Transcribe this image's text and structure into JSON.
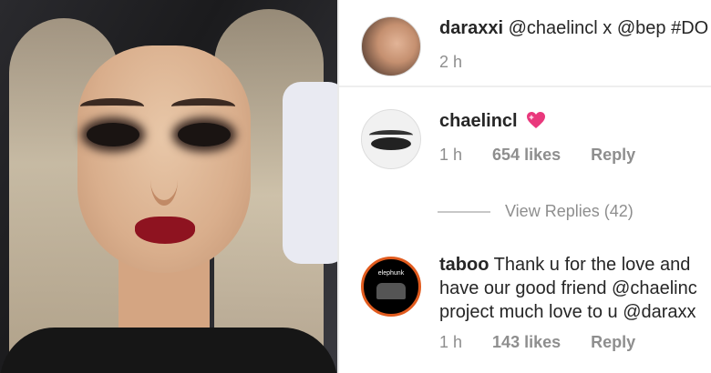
{
  "comments": [
    {
      "username": "daraxxi",
      "text": "@chaelincl x @bep #DO",
      "time": "2 h"
    },
    {
      "username": "chaelincl",
      "emoji": "sparkling-heart-icon",
      "time": "1 h",
      "likes": "654 likes",
      "reply": "Reply"
    },
    {
      "username": "taboo",
      "lines": [
        "Thank u for the love and",
        "have our good friend @chaelinc",
        "project much love to u @daraxx"
      ],
      "avatar_text": "elephunk",
      "time": "1 h",
      "likes": "143 likes",
      "reply": "Reply"
    }
  ],
  "view_replies": "View Replies (42)",
  "colors": {
    "text": "#262626",
    "muted": "#8e8e8e",
    "heart": "#e9387c",
    "taboo_ring": "#e15b1e"
  }
}
